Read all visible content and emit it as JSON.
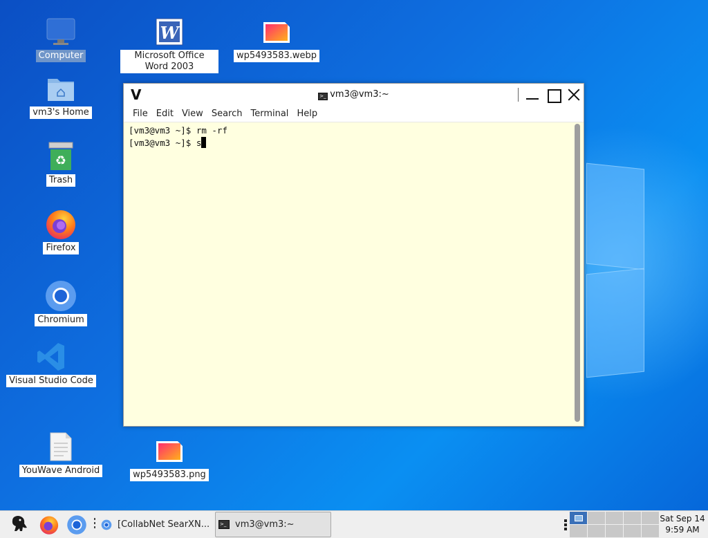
{
  "desktop": {
    "icons": {
      "computer": "Computer",
      "word": "Microsoft Office Word 2003",
      "webp": "wp5493583.webp",
      "home": "vm3's Home",
      "trash": "Trash",
      "firefox": "Firefox",
      "chromium": "Chromium",
      "vscode": "Visual Studio Code",
      "youwave": "YouWave Android",
      "png": "wp5493583.png"
    }
  },
  "terminal": {
    "title": "vm3@vm3:~",
    "menu": [
      "File",
      "Edit",
      "View",
      "Search",
      "Terminal",
      "Help"
    ],
    "lines": [
      "[vm3@vm3 ~]$ rm -rf",
      "[vm3@vm3 ~]$ s"
    ]
  },
  "taskbar": {
    "tasks": {
      "searx": "[CollabNet SearXN...",
      "terminal": "vm3@vm3:~"
    },
    "clock": {
      "date": "Sat Sep 14",
      "time": "9:59 AM"
    }
  },
  "colors": {
    "terminal_bg": "#ffffe0",
    "desktop_blue": "#0e6fe0",
    "pager_active": "#3a70b8"
  }
}
